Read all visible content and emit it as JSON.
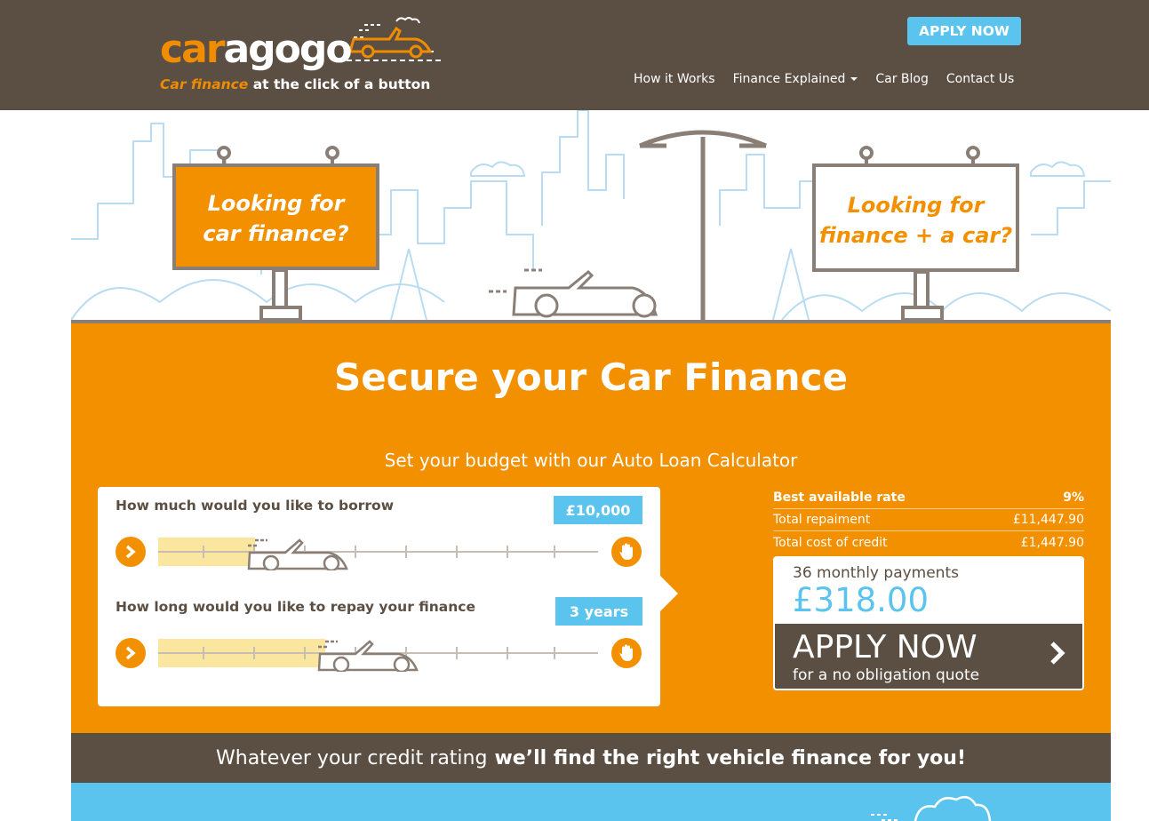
{
  "header": {
    "logo_car": "car",
    "logo_agogo": "agogo",
    "tagline_highlight": "Car finance",
    "tagline_rest": " at the click of a button",
    "apply_label": "APPLY NOW",
    "nav": [
      "How it Works",
      "Finance Explained",
      "Car Blog",
      "Contact Us"
    ]
  },
  "hero": {
    "sign_left": [
      "Looking for",
      "car finance?"
    ],
    "sign_right": [
      "Looking for",
      "finance + a car?"
    ]
  },
  "main": {
    "title": "Secure your Car Finance",
    "subtitle": "Set your budget with our Auto Loan Calculator",
    "borrow_question": "How much would you like to borrow",
    "borrow_value": "£10,000",
    "borrow_level": 0.22,
    "repay_question": "How long would you like to repay your finance",
    "repay_value": "3 years",
    "repay_level": 0.38
  },
  "rates": {
    "best_rate_label": "Best available rate",
    "best_rate_value": "9%",
    "total_repayment_label": "Total repaiment",
    "total_repayment_value": "£11,447.90",
    "cost_credit_label": "Total cost of credit",
    "cost_credit_value": "£1,447.90"
  },
  "payment": {
    "label": "36 monthly payments",
    "amount": "£318.00",
    "apply_big": "APPLY NOW",
    "apply_small": "for a no obligation quote"
  },
  "band": {
    "normal": "Whatever your credit rating",
    "bold": "we’ll find the right vehicle finance for you!"
  },
  "colors": {
    "brand_brown": "#5b4e42",
    "brand_orange": "#f29000",
    "brand_blue": "#5bc4ee"
  }
}
